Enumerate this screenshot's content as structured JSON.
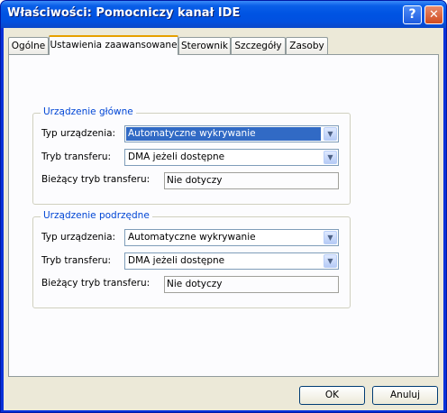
{
  "window": {
    "title": "Właściwości: Pomocniczy kanał IDE"
  },
  "titlebar_buttons": {
    "help": "?",
    "close": "✕"
  },
  "tabs": [
    {
      "label": "Ogólne"
    },
    {
      "label": "Ustawienia zaawansowane"
    },
    {
      "label": "Sterownik"
    },
    {
      "label": "Szczegóły"
    },
    {
      "label": "Zasoby"
    }
  ],
  "active_tab": "Ustawienia zaawansowane",
  "groups": {
    "primary": {
      "title": "Urządzenie główne",
      "device_type_label": "Typ urządzenia:",
      "device_type_value": "Automatyczne wykrywanie",
      "transfer_mode_label": "Tryb transferu:",
      "transfer_mode_value": "DMA jeżeli dostępne",
      "current_mode_label": "Bieżący tryb transferu:",
      "current_mode_value": "Nie dotyczy"
    },
    "secondary": {
      "title": "Urządzenie podrzędne",
      "device_type_label": "Typ urządzenia:",
      "device_type_value": "Automatyczne wykrywanie",
      "transfer_mode_label": "Tryb transferu:",
      "transfer_mode_value": "DMA jeżeli dostępne",
      "current_mode_label": "Bieżący tryb transferu:",
      "current_mode_value": "Nie dotyczy"
    }
  },
  "buttons": {
    "ok": "OK",
    "cancel": "Anuluj"
  },
  "icons": {
    "dropdown": "chevron-down-icon",
    "help": "help-icon",
    "close": "close-icon"
  },
  "colors": {
    "titlebar": "#0054e3",
    "group_title": "#0046d5",
    "selection": "#316ac5",
    "dialog_bg": "#ece9d8"
  }
}
